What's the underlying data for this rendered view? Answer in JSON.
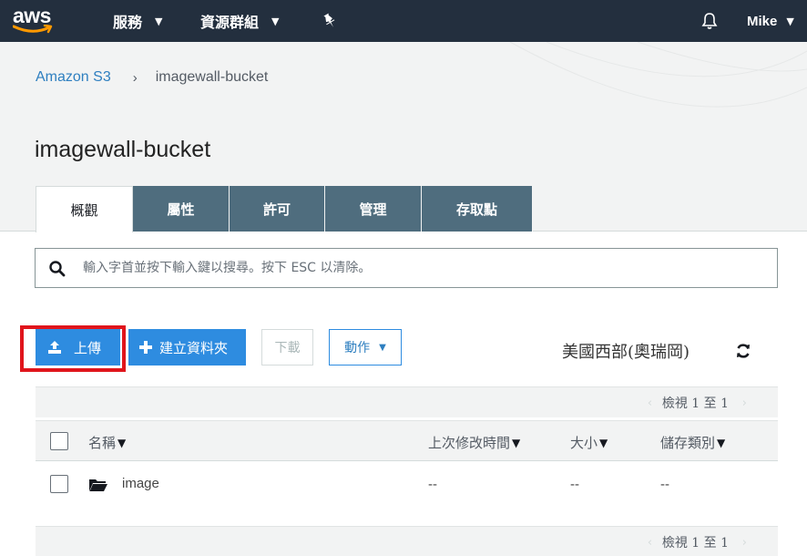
{
  "topnav": {
    "logo": "aws",
    "services": "服務",
    "resource_groups": "資源群組",
    "pin_icon": "pin-icon",
    "bell_icon": "bell-icon",
    "user": "Mike"
  },
  "breadcrumb": {
    "root": "Amazon S3",
    "separator": "›",
    "current": "imagewall-bucket"
  },
  "page_title": "imagewall-bucket",
  "tabs": [
    {
      "label": "概觀",
      "active": true
    },
    {
      "label": "屬性",
      "active": false
    },
    {
      "label": "許可",
      "active": false
    },
    {
      "label": "管理",
      "active": false
    },
    {
      "label": "存取點",
      "active": false
    }
  ],
  "search": {
    "placeholder": "輸入字首並按下輸入鍵以搜尋。按下 ESC 以清除。"
  },
  "toolbar": {
    "upload": "上傳",
    "create_folder": "建立資料夾",
    "download": "下載",
    "actions": "動作",
    "region": "美國西部(奧瑞岡)"
  },
  "pager": {
    "text": "檢視 1 至 1",
    "prev": "‹",
    "next": "›"
  },
  "table": {
    "columns": [
      "名稱",
      "上次修改時間",
      "大小",
      "儲存類別"
    ],
    "rows": [
      {
        "name": "image",
        "type": "folder",
        "modified": "--",
        "size": "--",
        "storage_class": "--"
      }
    ]
  },
  "colors": {
    "nav_bg": "#232f3e",
    "accent": "#2e8ce0",
    "tab_bg": "#4f6d7e",
    "highlight": "#e0151c"
  }
}
